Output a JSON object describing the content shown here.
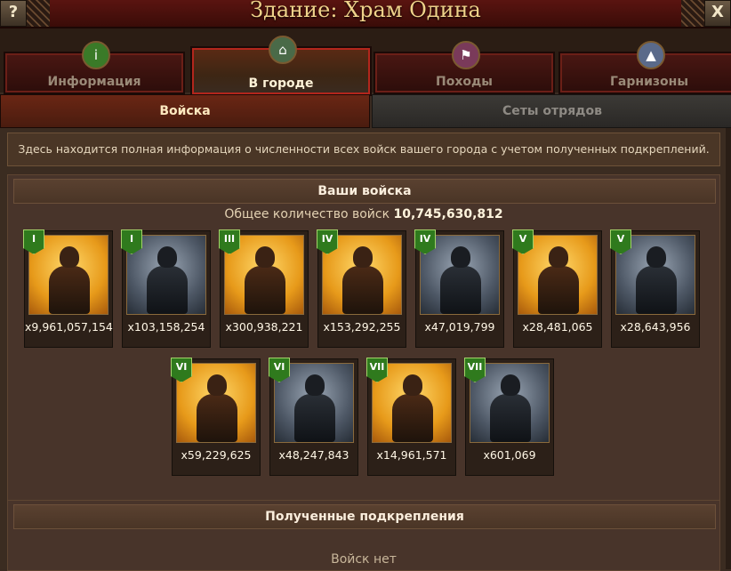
{
  "window": {
    "title": "Здание: Храм Одина",
    "help_label": "?",
    "close_label": "X"
  },
  "tabs": [
    {
      "label": "Информация",
      "icon": "info-icon",
      "active": false
    },
    {
      "label": "В городе",
      "icon": "city-icon",
      "active": true
    },
    {
      "label": "Походы",
      "icon": "march-icon",
      "active": false
    },
    {
      "label": "Гарнизоны",
      "icon": "garrison-icon",
      "active": false
    }
  ],
  "subtabs": [
    {
      "label": "Войска",
      "active": true
    },
    {
      "label": "Сеты отрядов",
      "active": false
    }
  ],
  "info_text": "Здесь находится полная информация о численности всех войск вашего города с учетом полученных подкреплений.",
  "troops_panel": {
    "title": "Ваши войска",
    "total_label": "Общее количество войск",
    "total_value": "10,745,630,812"
  },
  "troops": [
    {
      "tier": "I",
      "count": "x9,961,057,154",
      "palette": "gold"
    },
    {
      "tier": "I",
      "count": "x103,158,254",
      "palette": "grey"
    },
    {
      "tier": "III",
      "count": "x300,938,221",
      "palette": "gold"
    },
    {
      "tier": "IV",
      "count": "x153,292,255",
      "palette": "gold"
    },
    {
      "tier": "IV",
      "count": "x47,019,799",
      "palette": "grey"
    },
    {
      "tier": "V",
      "count": "x28,481,065",
      "palette": "gold"
    },
    {
      "tier": "V",
      "count": "x28,643,956",
      "palette": "grey"
    },
    {
      "tier": "VI",
      "count": "x59,229,625",
      "palette": "gold"
    },
    {
      "tier": "VI",
      "count": "x48,247,843",
      "palette": "grey"
    },
    {
      "tier": "VII",
      "count": "x14,961,571",
      "palette": "gold"
    },
    {
      "tier": "VII",
      "count": "x601,069",
      "palette": "grey"
    }
  ],
  "reinforcements": {
    "title": "Полученные подкрепления",
    "empty_text": "Войск нет"
  }
}
